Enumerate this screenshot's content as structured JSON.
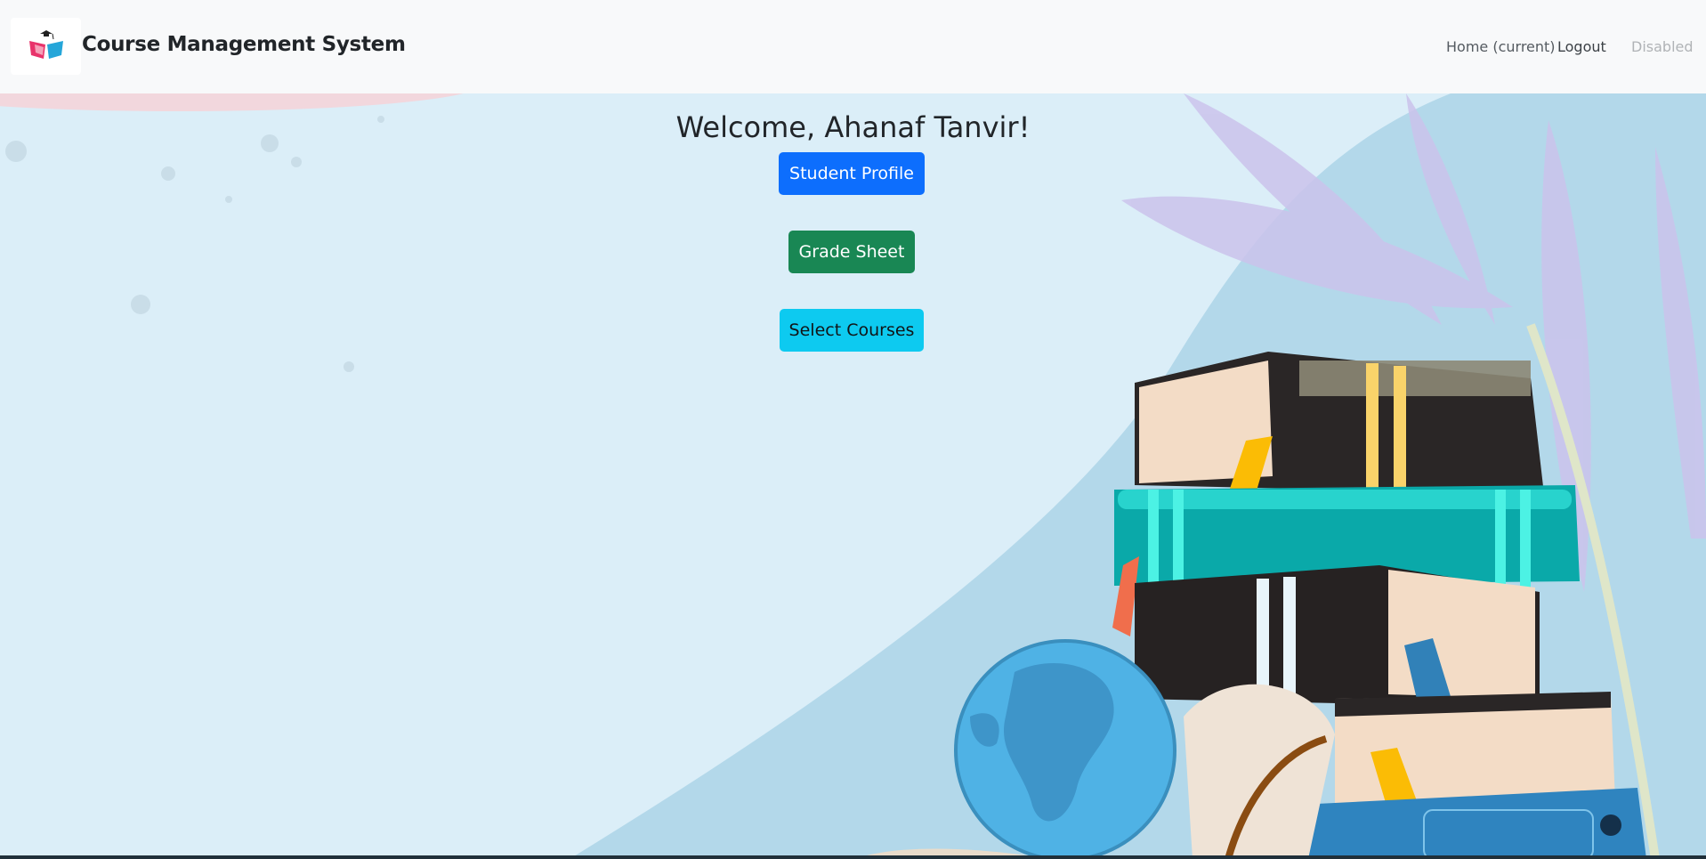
{
  "navbar": {
    "brand": "Course Management System",
    "links": {
      "home": "Home (current)",
      "logout": "Logout",
      "disabled": "Disabled"
    }
  },
  "main": {
    "welcome": "Welcome, Ahanaf Tanvir!",
    "buttons": {
      "student_profile": "Student Profile",
      "grade_sheet": "Grade Sheet",
      "select_courses": "Select Courses"
    }
  },
  "colors": {
    "primary": "#0d6efd",
    "success": "#198754",
    "info": "#0dcaf0",
    "background": "#dbeef8"
  }
}
